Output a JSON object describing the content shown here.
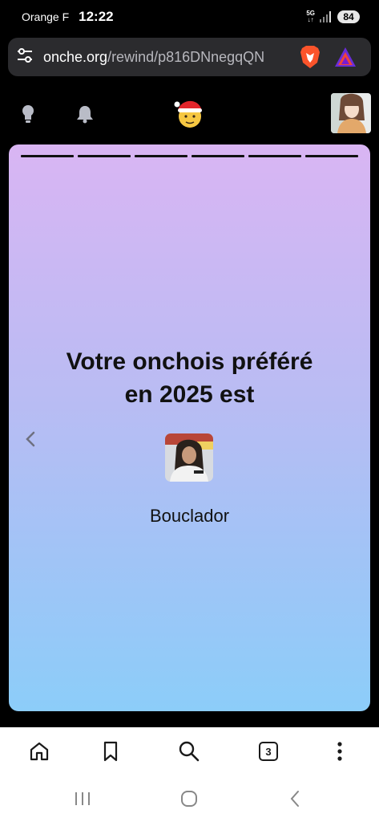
{
  "status_bar": {
    "carrier": "Orange F",
    "time": "12:22",
    "network": "5G",
    "battery": "84"
  },
  "browser": {
    "url_domain": "onche.org",
    "url_path": "/rewind/p816DNnegqQN",
    "site_settings_icon": "tune-icon",
    "shields_icon": "brave-lion-icon",
    "rewards_icon": "brave-rewards-icon"
  },
  "site_nav": {
    "icons": [
      "lightbulb-icon",
      "bell-icon",
      "santa-emoji-icon",
      "user-avatar"
    ]
  },
  "story": {
    "segment_count": 6,
    "title_line1": "Votre onchois préféré",
    "title_line2": "en 2025 est",
    "favorite_name": "Bouclador",
    "colors": {
      "top": "#d9b5f3",
      "bottom": "#8ccdf9"
    }
  },
  "toolbar": {
    "tabs_count": "3",
    "icons": [
      "home-icon",
      "bookmark-icon",
      "search-icon",
      "tabs-icon",
      "more-icon"
    ]
  },
  "system_nav": {
    "icons": [
      "recents-icon",
      "home-circle-icon",
      "back-icon"
    ]
  }
}
